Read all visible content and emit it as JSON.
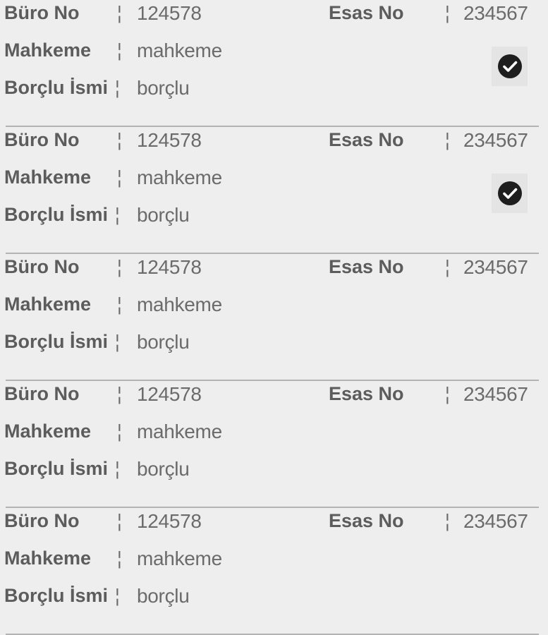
{
  "labels": {
    "buro_no": "Büro No",
    "esas_no": "Esas No",
    "mahkeme": "Mahkeme",
    "borclu_ismi": "Borçlu İsmi",
    "separator": "¦"
  },
  "records": [
    {
      "buro_no": "124578",
      "esas_no": "234567",
      "mahkeme": "mahkeme",
      "borclu": "borçlu",
      "selected": true
    },
    {
      "buro_no": "124578",
      "esas_no": "234567",
      "mahkeme": "mahkeme",
      "borclu": "borçlu",
      "selected": true
    },
    {
      "buro_no": "124578",
      "esas_no": "234567",
      "mahkeme": "mahkeme",
      "borclu": "borçlu",
      "selected": false
    },
    {
      "buro_no": "124578",
      "esas_no": "234567",
      "mahkeme": "mahkeme",
      "borclu": "borçlu",
      "selected": false
    },
    {
      "buro_no": "124578",
      "esas_no": "234567",
      "mahkeme": "mahkeme",
      "borclu": "borçlu",
      "selected": false
    }
  ],
  "icons": {
    "selected": "check-circle-icon"
  },
  "colors": {
    "background": "#eeeeee",
    "label": "#5c5c5c",
    "value": "#6b6b6b",
    "divider": "#b3b3b3",
    "check": "#1e1e1e"
  }
}
